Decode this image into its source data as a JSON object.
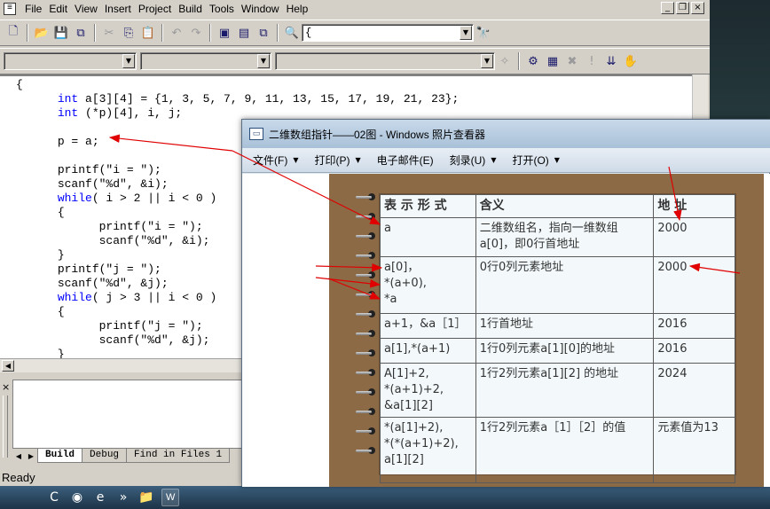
{
  "ide": {
    "menu": [
      "File",
      "Edit",
      "View",
      "Insert",
      "Project",
      "Build",
      "Tools",
      "Window",
      "Help"
    ],
    "find_combo_value": "{",
    "code_lines": [
      {
        "indent": 0,
        "parts": [
          {
            "t": "{"
          }
        ]
      },
      {
        "indent": 1,
        "parts": [
          {
            "t": "int",
            "kw": true
          },
          {
            "t": " a[3][4] = {1, 3, 5, 7, 9, 11, 13, 15, 17, 19, 21, 23};"
          }
        ]
      },
      {
        "indent": 1,
        "parts": [
          {
            "t": "int",
            "kw": true
          },
          {
            "t": " (*p)[4], i, j;"
          }
        ]
      },
      {
        "indent": 0,
        "parts": []
      },
      {
        "indent": 1,
        "parts": [
          {
            "t": "p = a;"
          }
        ]
      },
      {
        "indent": 0,
        "parts": []
      },
      {
        "indent": 1,
        "parts": [
          {
            "t": "printf(\"i = \");"
          }
        ]
      },
      {
        "indent": 1,
        "parts": [
          {
            "t": "scanf(\"%d\", &i);"
          }
        ]
      },
      {
        "indent": 1,
        "parts": [
          {
            "t": "while",
            "kw": true
          },
          {
            "t": "( i > 2 || i < 0 )"
          }
        ]
      },
      {
        "indent": 1,
        "parts": [
          {
            "t": "{"
          }
        ]
      },
      {
        "indent": 2,
        "parts": [
          {
            "t": "printf(\"i = \");"
          }
        ]
      },
      {
        "indent": 2,
        "parts": [
          {
            "t": "scanf(\"%d\", &i);"
          }
        ]
      },
      {
        "indent": 1,
        "parts": [
          {
            "t": "}"
          }
        ]
      },
      {
        "indent": 1,
        "parts": [
          {
            "t": "printf(\"j = \");"
          }
        ]
      },
      {
        "indent": 1,
        "parts": [
          {
            "t": "scanf(\"%d\", &j);"
          }
        ]
      },
      {
        "indent": 1,
        "parts": [
          {
            "t": "while",
            "kw": true
          },
          {
            "t": "( j > 3 || i < 0 )"
          }
        ]
      },
      {
        "indent": 1,
        "parts": [
          {
            "t": "{"
          }
        ]
      },
      {
        "indent": 2,
        "parts": [
          {
            "t": "printf(\"j = \");"
          }
        ]
      },
      {
        "indent": 2,
        "parts": [
          {
            "t": "scanf(\"%d\", &j);"
          }
        ]
      },
      {
        "indent": 1,
        "parts": [
          {
            "t": "}"
          }
        ]
      }
    ],
    "output_tabs": [
      "Build",
      "Debug",
      "Find in Files 1"
    ],
    "status": "Ready"
  },
  "taskbar": {
    "button_label": "W"
  },
  "viewer": {
    "title": "二维数组指针——02图 - Windows 照片查看器",
    "menu": [
      {
        "label": "文件(F)",
        "dropdown": true
      },
      {
        "label": "打印(P)",
        "dropdown": true
      },
      {
        "label": "电子邮件(E)",
        "dropdown": false
      },
      {
        "label": "刻录(U)",
        "dropdown": true
      },
      {
        "label": "打开(O)",
        "dropdown": true
      }
    ],
    "table": {
      "headers": [
        "表 示 形 式",
        "含义",
        "地 址"
      ],
      "rows": [
        [
          "a",
          "二维数组名，指向一维数组a[0]，即0行首地址",
          "2000"
        ],
        [
          "a[0]，\n*(a+0),\n*a",
          "0行0列元素地址",
          "2000"
        ],
        [
          "a+1，&a［1］",
          "1行首地址",
          "2016"
        ],
        [
          "a[1],*(a+1)",
          "1行0列元素a[1][0]的地址",
          "2016"
        ],
        [
          "A[1]+2,\n*(a+1)+2,\n&a[1][2]",
          "1行2列元素a[1][2] 的地址",
          "2024"
        ],
        [
          "*(a[1]+2),\n*(*(a+1)+2),\na[1][2]",
          "1行2列元素a［1］［2］的值",
          "元素值为13"
        ]
      ]
    }
  }
}
